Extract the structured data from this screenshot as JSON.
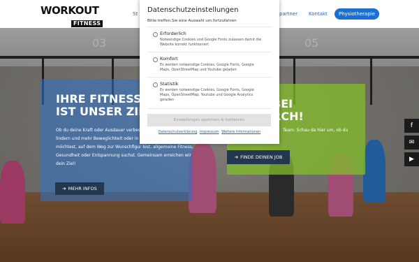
{
  "header": {
    "logo": {
      "word": "WORKOUT",
      "sub": "FITNESS"
    },
    "nav": {
      "partial_left": "St",
      "partial_right": "partner",
      "contact": "Kontakt",
      "cta": "Physiotherapie"
    }
  },
  "hero": {
    "blue_panel": {
      "heading": "IHRE FITNESS\nIST UNSER ZIEL",
      "text": "Ob du deine Kraft oder Ausdauer verbessern, deine Schmerzen lindern und mehr Beweglichkeit oder in den Gelenken erzielen möchtest, auf dem Weg zur Wunschfigur bist, allgemeine Fitness, Gesundheit oder Entspannung suchst. Gemeinsam erreichen wir dein Ziel!",
      "button": "MEHR INFOS"
    },
    "green_panel": {
      "heading": "BEI\nRCH!",
      "text": "Team. Schau da hier um, ob du",
      "button": "FINDE DEINEN JOB"
    },
    "wall_numbers": [
      "03",
      "05"
    ]
  },
  "social": [
    {
      "icon": "facebook-icon",
      "glyph": "f"
    },
    {
      "icon": "mail-icon",
      "glyph": "✉"
    },
    {
      "icon": "youtube-icon",
      "glyph": "▶"
    }
  ],
  "cookie_modal": {
    "title": "Datenschutzeinstellungen",
    "subtitle": "Bitte treffen Sie eine Auswahl um fortzufahren",
    "options": [
      {
        "title": "Erforderlich",
        "description": "Notwendige Cookies und Google Fonts zulassen damit die Website korrekt funktioniert"
      },
      {
        "title": "Komfort",
        "description": "Es werden notwendige Cookies, Google Fonts, Google Maps, OpenStreetMap und Youtube geladen"
      },
      {
        "title": "Statistik",
        "description": "Es werden notwendige Cookies, Google Fonts, Google Maps, OpenStreetMap, Youtube und Google Analytics geladen"
      }
    ],
    "save_button": "Einstellungen speichern & fortfahren",
    "links": [
      "Datenschutzerklärung",
      "Impressum",
      "Weitere Informationen"
    ]
  },
  "colors": {
    "accent_blue": "#1b6fd1",
    "panel_blue": "#2d73c8",
    "panel_green": "#82be28",
    "button_dark": "#23384f"
  }
}
